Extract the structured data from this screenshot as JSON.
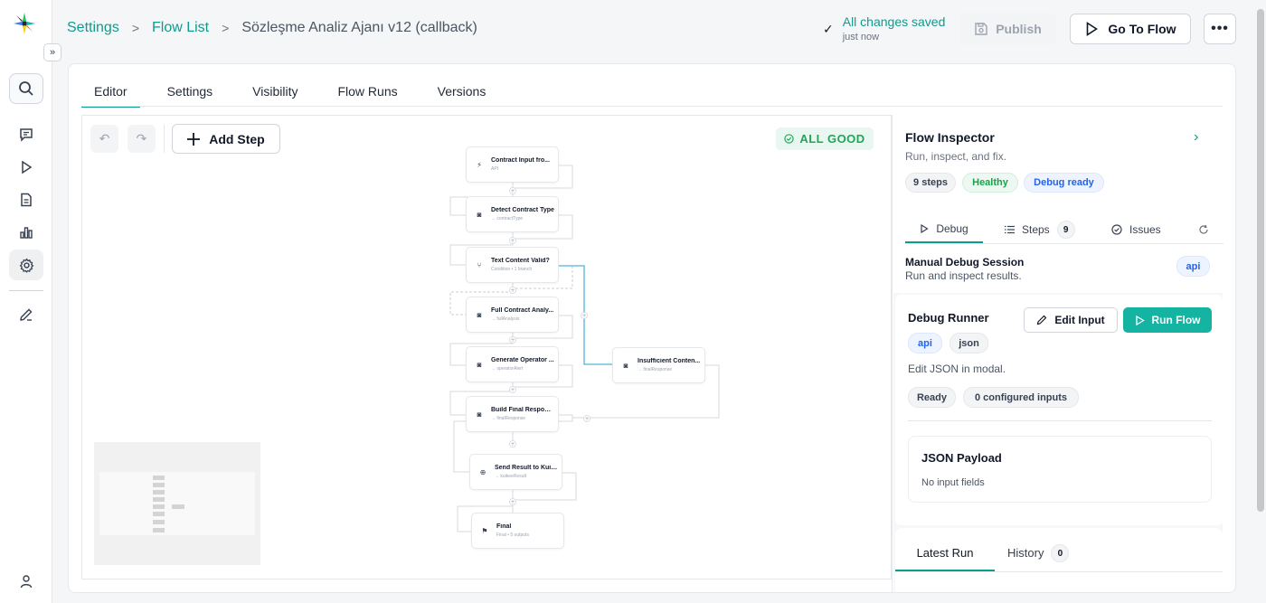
{
  "breadcrumb": {
    "settings": "Settings",
    "flow_list": "Flow List",
    "current": "Sözleşme Analiz Ajanı v12 (callback)"
  },
  "header": {
    "saved": "All changes saved",
    "saved_time": "just now",
    "publish": "Publish",
    "go_to_flow": "Go To Flow"
  },
  "tabs": [
    "Editor",
    "Settings",
    "Visibility",
    "Flow Runs",
    "Versions"
  ],
  "canvas": {
    "add_step": "Add Step",
    "status": "ALL GOOD",
    "nodes": [
      {
        "title": "Contract Input fro...",
        "sub": "API"
      },
      {
        "title": "Detect Contract Type",
        "sub": "→ contractType"
      },
      {
        "title": "Text Content Valid?",
        "sub": "Condition • 1 branch"
      },
      {
        "title": "Full Contract Analy...",
        "sub": "→ fullAnalysis"
      },
      {
        "title": "Generate Operator ...",
        "sub": "→ operatorAlert"
      },
      {
        "title": "Insufficient Conten...",
        "sub": "→ finalResponse"
      },
      {
        "title": "Build Final Response",
        "sub": "→ finalResponse"
      },
      {
        "title": "Send Result to Kuik...",
        "sub": "→ kuikeeResult"
      },
      {
        "title": "Final",
        "sub": "Final • 5 outputs"
      }
    ]
  },
  "inspector": {
    "title": "Flow Inspector",
    "subtitle": "Run, inspect, and fix.",
    "badges": [
      "9 steps",
      "Healthy",
      "Debug ready"
    ],
    "tabs": {
      "debug": "Debug",
      "steps": "Steps",
      "steps_count": "9",
      "issues": "Issues"
    },
    "session_title": "Manual Debug Session",
    "session_sub": "Run and inspect results.",
    "session_badge": "api",
    "runner": {
      "title": "Debug Runner",
      "edit_input": "Edit Input",
      "run_flow": "Run Flow",
      "tags": [
        "api",
        "json"
      ],
      "hint": "Edit JSON in modal.",
      "status": [
        "Ready",
        "0 configured inputs"
      ]
    },
    "payload": {
      "title": "JSON Payload",
      "empty": "No input fields"
    },
    "latest": {
      "tab": "Latest Run",
      "history": "History",
      "history_count": "0"
    }
  },
  "colors": {
    "accent": "#0f9b8e",
    "run_button": "#14b3a2",
    "good": "#22a55a"
  }
}
